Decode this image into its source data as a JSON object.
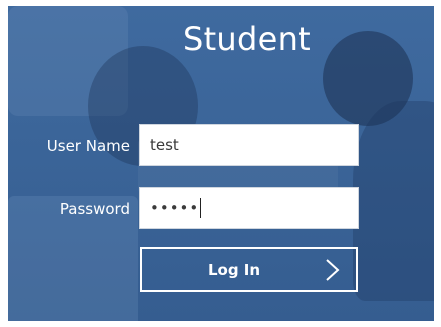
{
  "title": "Student",
  "form": {
    "username_label": "User Name",
    "username_value": "test",
    "password_label": "Password",
    "password_masked": "•••••",
    "login_label": "Log In"
  },
  "icons": {
    "login_arrow": "chevron-right-icon"
  },
  "colors": {
    "panel_blue": "#3b6599",
    "text": "#ffffff",
    "field_bg": "#ffffff"
  }
}
